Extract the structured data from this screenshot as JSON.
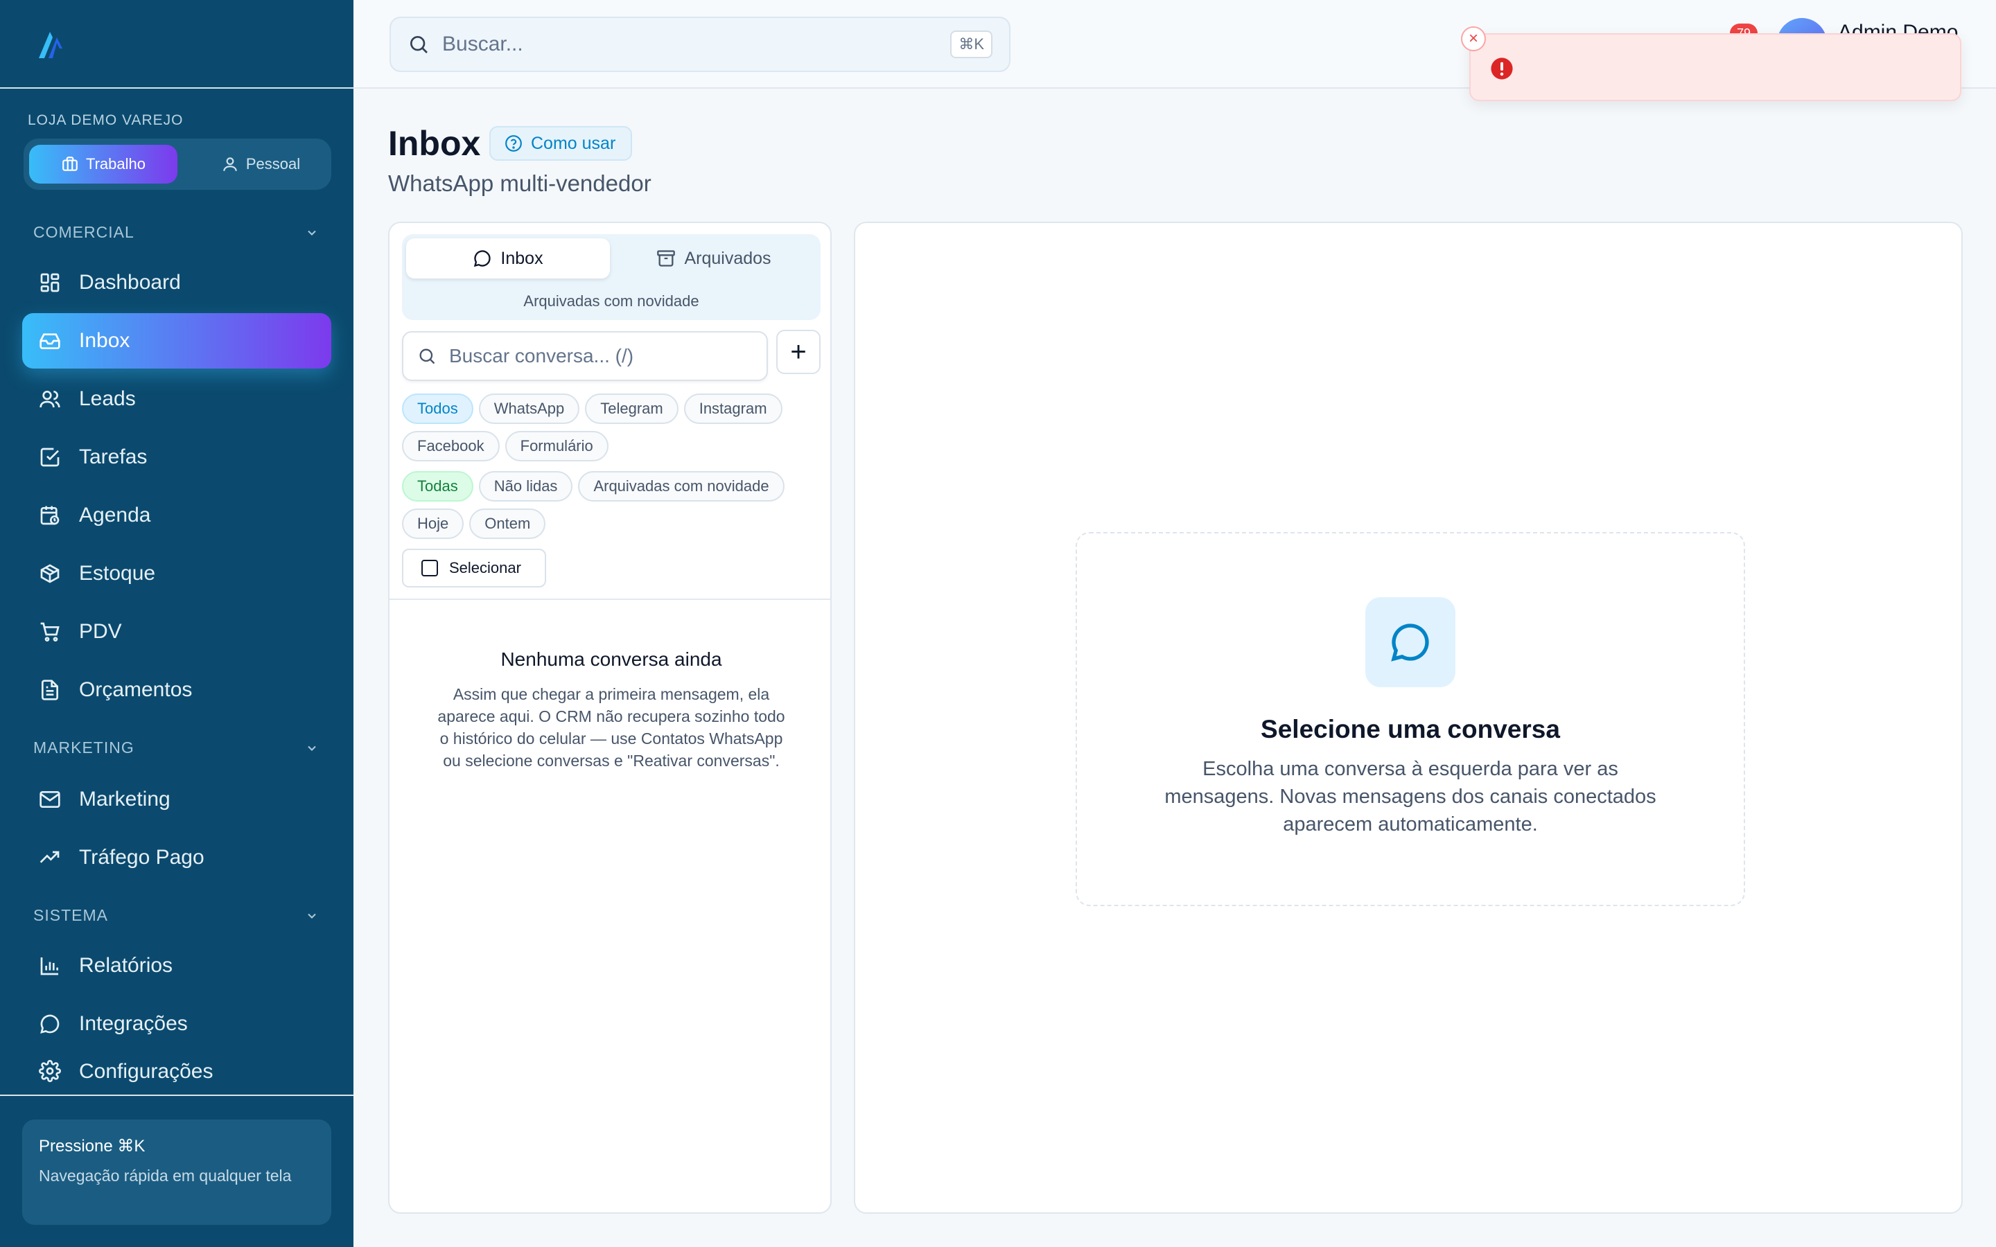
{
  "sidebar": {
    "store_label": "LOJA DEMO VAREJO",
    "modes": {
      "work": "Trabalho",
      "personal": "Pessoal"
    },
    "sections": {
      "comercial": "COMERCIAL",
      "marketing": "MARKETING",
      "sistema": "SISTEMA"
    },
    "items": {
      "dashboard": "Dashboard",
      "inbox": "Inbox",
      "leads": "Leads",
      "tarefas": "Tarefas",
      "agenda": "Agenda",
      "estoque": "Estoque",
      "pdv": "PDV",
      "orcamentos": "Orçamentos",
      "marketing": "Marketing",
      "trafego": "Tráfego Pago",
      "relatorios": "Relatórios",
      "integracoes": "Integrações",
      "configuracoes": "Configurações"
    },
    "tip": {
      "title": "Pressione ⌘K",
      "text": "Navegação rápida em qualquer tela"
    },
    "colors": {
      "bg": "#0b4a6e",
      "accent_start": "#38bdf8",
      "accent_end": "#7c3aed"
    }
  },
  "topbar": {
    "search_placeholder": "Buscar...",
    "search_shortcut": "⌘K",
    "notification_count": "79",
    "user_name": "Admin Demo"
  },
  "toast": {
    "close_label": "×",
    "type": "error"
  },
  "page": {
    "title": "Inbox",
    "howto_label": "Como usar",
    "subtitle": "WhatsApp multi-vendedor"
  },
  "inbox": {
    "tabs": {
      "inbox": "Inbox",
      "archived": "Arquivados"
    },
    "tab_sub": "Arquivadas com novidade",
    "search_placeholder": "Buscar conversa... (/)",
    "add_label": "+",
    "channel_filters": [
      "Todos",
      "WhatsApp",
      "Telegram",
      "Instagram",
      "Facebook",
      "Formulário"
    ],
    "status_filters": [
      "Todas",
      "Não lidas",
      "Arquivadas com novidade",
      "Hoje",
      "Ontem"
    ],
    "select_label": "Selecionar",
    "empty_title": "Nenhuma conversa ainda",
    "empty_text": "Assim que chegar a primeira mensagem, ela aparece aqui. O CRM não recupera sozinho todo o histórico do celular — use Contatos WhatsApp ou selecione conversas e \"Reativar conversas\"."
  },
  "detail": {
    "title": "Selecione uma conversa",
    "text": "Escolha uma conversa à esquerda para ver as mensagens. Novas mensagens dos canais conectados aparecem automaticamente."
  }
}
